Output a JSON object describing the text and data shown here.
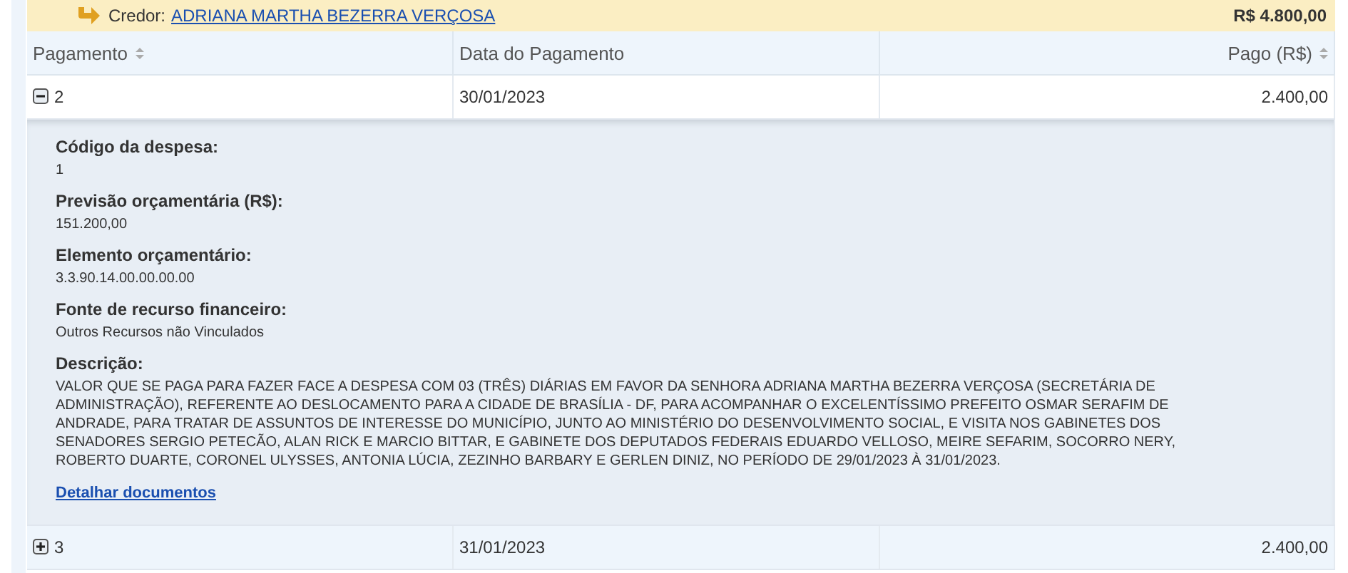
{
  "creditor": {
    "label": "Credor:",
    "name": "ADRIANA MARTHA BEZERRA VERÇOSA",
    "total": "R$ 4.800,00"
  },
  "table": {
    "columns": [
      {
        "label": "Pagamento",
        "sortable": true
      },
      {
        "label": "Data do Pagamento",
        "sortable": false
      },
      {
        "label": "Pago (R$)",
        "sortable": true
      }
    ],
    "rows": [
      {
        "expanded": true,
        "cells": [
          "2",
          "30/01/2023",
          "2.400,00"
        ],
        "details": [
          {
            "label": "Código da despesa:",
            "value": "1"
          },
          {
            "label": "Previsão orçamentária (R$):",
            "value": "151.200,00"
          },
          {
            "label": "Elemento orçamentário:",
            "value": "3.3.90.14.00.00.00.00"
          },
          {
            "label": "Fonte de recurso financeiro:",
            "value": "Outros Recursos não Vinculados"
          },
          {
            "label": "Descrição:",
            "value": "VALOR QUE SE PAGA PARA FAZER FACE A DESPESA COM 03 (TRÊS) DIÁRIAS EM FAVOR DA SENHORA ADRIANA MARTHA BEZERRA VERÇOSA (SECRETÁRIA DE ADMINISTRAÇÃO), REFERENTE AO DESLOCAMENTO PARA A CIDADE DE BRASÍLIA - DF, PARA ACOMPANHAR O EXCELENTÍSSIMO PREFEITO OSMAR SERAFIM DE ANDRADE, PARA TRATAR DE ASSUNTOS DE INTERESSE DO MUNICÍPIO, JUNTO AO MINISTÉRIO DO DESENVOLVIMENTO SOCIAL, E VISITA NOS GABINETES DOS SENADORES SERGIO PETECÃO, ALAN RICK E MARCIO BITTAR, E GABINETE DOS DEPUTADOS FEDERAIS EDUARDO VELLOSO, MEIRE SEFARIM, SOCORRO NERY, ROBERTO DUARTE, CORONEL ULYSSES, ANTONIA LÚCIA, ZEZINHO BARBARY E GERLEN DINIZ, NO PERÍODO DE 29/01/2023 À 31/01/2023."
          }
        ],
        "link": "Detalhar documentos"
      },
      {
        "expanded": false,
        "cells": [
          "3",
          "31/01/2023",
          "2.400,00"
        ]
      }
    ]
  }
}
